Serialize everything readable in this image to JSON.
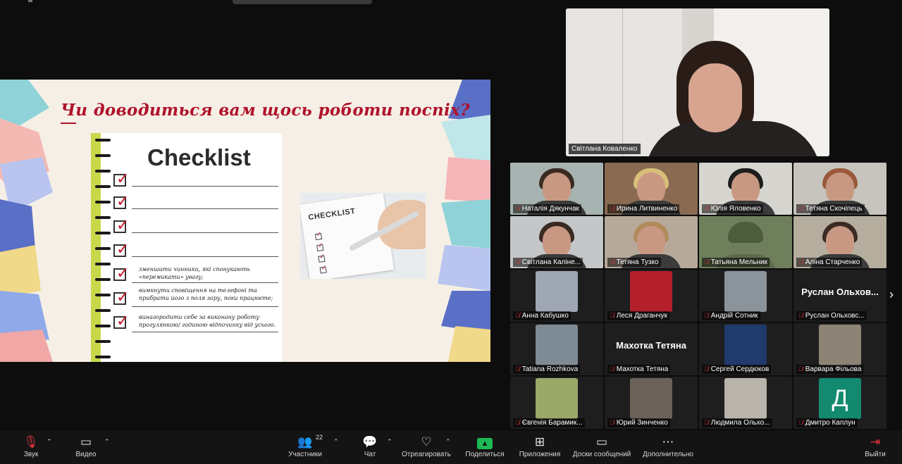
{
  "slide": {
    "title": "Чи доводиться вам щось роботи поспіх?",
    "checklist_heading": "Checklist",
    "items": [
      "зменшити чинники, які спонукають «перемикати» увагу;",
      "вимкнути сповіщення на телефоні та прибрати його з поля зору, поки працюєте;",
      "винагородити себе за виконану роботу прогулянкою/ годиною відпочинку від усього."
    ],
    "photo_word": "CHECKLIST"
  },
  "speaker": {
    "name": "Світлана Коваленко"
  },
  "gallery": {
    "video_tiles": [
      "Наталія Дякунчак",
      "Ирина Литвиненко",
      "Юлія Яловенко",
      "Тетяна Скочіпець",
      "Світлана Каліне...",
      "Тетяна Тузко",
      "Татьяна Мельник",
      "Аліна Старченко"
    ],
    "avatar_tiles": [
      {
        "name": "Анна Кабушко",
        "type": "photo"
      },
      {
        "name": "Леся Драганчук",
        "type": "photo"
      },
      {
        "name": "Андрій Сотник",
        "type": "photo"
      },
      {
        "name": "Руслан Ольховс...",
        "type": "text",
        "big": "Руслан Ольхов..."
      },
      {
        "name": "Tatiana Rozhkova",
        "type": "photo"
      },
      {
        "name": "Махотка Тетяна",
        "type": "text",
        "big": "Махотка Тетяна"
      },
      {
        "name": "Сергей Сердюков",
        "type": "photo"
      },
      {
        "name": "Варвара Фільова",
        "type": "photo"
      },
      {
        "name": "Євгенія Барамик...",
        "type": "photo"
      },
      {
        "name": "Юрий Зинченко",
        "type": "photo"
      },
      {
        "name": "Людмила Ольхо...",
        "type": "photo"
      },
      {
        "name": "Дмитро Каплун",
        "type": "letter",
        "letter": "Д"
      }
    ],
    "next_arrow": "›"
  },
  "toolbar": {
    "audio": "Звук",
    "video": "Видео",
    "participants": "Участники",
    "participants_count": "22",
    "chat": "Чат",
    "react": "Отреагировать",
    "share": "Поделиться",
    "apps": "Приложения",
    "whiteboards": "Доски сообщений",
    "more": "Дополнительно",
    "leave": "Выйти"
  },
  "colors": {
    "title_red": "#b0122b",
    "mic_off_red": "#e0363c",
    "share_green": "#1db954",
    "letter_avatar": "#138a6f"
  }
}
